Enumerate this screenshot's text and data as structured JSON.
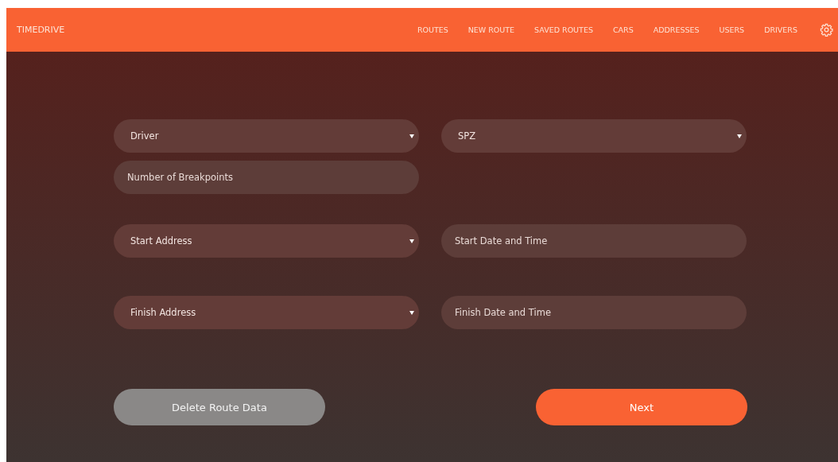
{
  "brand": "TIMEDRIVE",
  "nav": [
    {
      "label": "ROUTES"
    },
    {
      "label": "NEW ROUTE"
    },
    {
      "label": "SAVED ROUTES"
    },
    {
      "label": "CARS"
    },
    {
      "label": "ADDRESSES"
    },
    {
      "label": "USERS"
    },
    {
      "label": "DRIVERS"
    }
  ],
  "form_rows": [
    [
      {
        "kind": "select",
        "value": "Driver"
      },
      {
        "kind": "select",
        "value": "SPZ"
      }
    ],
    [
      {
        "kind": "input",
        "placeholder": "Number of Breakpoints"
      }
    ],
    [
      {
        "kind": "select",
        "value": "Start Address"
      },
      {
        "kind": "input",
        "placeholder": "Start Date and Time"
      }
    ],
    [
      {
        "kind": "select",
        "value": "Finish Address"
      },
      {
        "kind": "input",
        "placeholder": "Finish Date and Time"
      }
    ]
  ],
  "buttons": [
    {
      "label": "Delete Route Data",
      "kind": "secondary"
    },
    {
      "label": "Next",
      "kind": "primary"
    }
  ]
}
